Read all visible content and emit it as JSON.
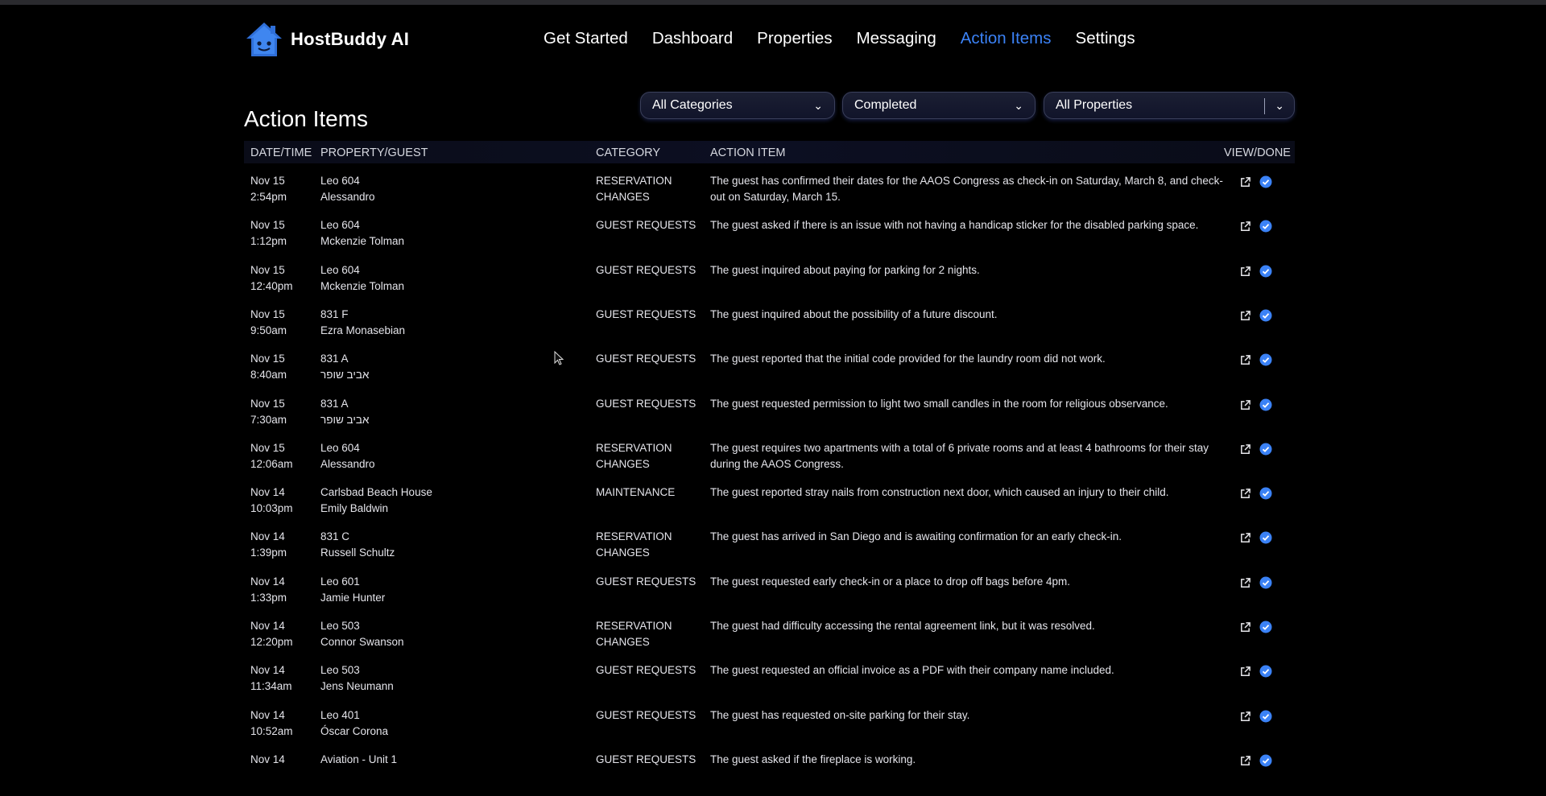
{
  "app": {
    "name": "HostBuddy AI"
  },
  "nav": {
    "items": [
      {
        "label": "Get Started",
        "active": false
      },
      {
        "label": "Dashboard",
        "active": false
      },
      {
        "label": "Properties",
        "active": false
      },
      {
        "label": "Messaging",
        "active": false
      },
      {
        "label": "Action Items",
        "active": true
      },
      {
        "label": "Settings",
        "active": false
      }
    ]
  },
  "page": {
    "title": "Action Items"
  },
  "filters": {
    "category": "All Categories",
    "status": "Completed",
    "properties": "All Properties"
  },
  "table": {
    "headers": {
      "datetime": "DATE/TIME",
      "property": "PROPERTY/GUEST",
      "category": "CATEGORY",
      "action": "ACTION ITEM",
      "view": "VIEW/DONE"
    },
    "rows": [
      {
        "date": "Nov 15",
        "time": "2:54pm",
        "property": "Leo 604",
        "guest": "Alessandro",
        "category": "RESERVATION CHANGES",
        "action": "The guest has confirmed their dates for the AAOS Congress as check-in on Saturday, March 8, and check-out on Saturday, March 15."
      },
      {
        "date": "Nov 15",
        "time": "1:12pm",
        "property": "Leo 604",
        "guest": "Mckenzie Tolman",
        "category": "GUEST REQUESTS",
        "action": "The guest asked if there is an issue with not having a handicap sticker for the disabled parking space."
      },
      {
        "date": "Nov 15",
        "time": "12:40pm",
        "property": "Leo 604",
        "guest": "Mckenzie Tolman",
        "category": "GUEST REQUESTS",
        "action": "The guest inquired about paying for parking for 2 nights."
      },
      {
        "date": "Nov 15",
        "time": "9:50am",
        "property": "831 F",
        "guest": "Ezra Monasebian",
        "category": "GUEST REQUESTS",
        "action": "The guest inquired about the possibility of a future discount."
      },
      {
        "date": "Nov 15",
        "time": "8:40am",
        "property": "831 A",
        "guest": "אביב שופר",
        "category": "GUEST REQUESTS",
        "action": "The guest reported that the initial code provided for the laundry room did not work."
      },
      {
        "date": "Nov 15",
        "time": "7:30am",
        "property": "831 A",
        "guest": "אביב שופר",
        "category": "GUEST REQUESTS",
        "action": "The guest requested permission to light two small candles in the room for religious observance."
      },
      {
        "date": "Nov 15",
        "time": "12:06am",
        "property": "Leo 604",
        "guest": "Alessandro",
        "category": "RESERVATION CHANGES",
        "action": "The guest requires two apartments with a total of 6 private rooms and at least 4 bathrooms for their stay during the AAOS Congress."
      },
      {
        "date": "Nov 14",
        "time": "10:03pm",
        "property": "Carlsbad Beach House",
        "guest": "Emily Baldwin",
        "category": "MAINTENANCE",
        "action": "The guest reported stray nails from construction next door, which caused an injury to their child."
      },
      {
        "date": "Nov 14",
        "time": "1:39pm",
        "property": "831 C",
        "guest": "Russell Schultz",
        "category": "RESERVATION CHANGES",
        "action": "The guest has arrived in San Diego and is awaiting confirmation for an early check-in."
      },
      {
        "date": "Nov 14",
        "time": "1:33pm",
        "property": "Leo 601",
        "guest": "Jamie Hunter",
        "category": "GUEST REQUESTS",
        "action": "The guest requested early check-in or a place to drop off bags before 4pm."
      },
      {
        "date": "Nov 14",
        "time": "12:20pm",
        "property": "Leo 503",
        "guest": "Connor Swanson",
        "category": "RESERVATION CHANGES",
        "action": "The guest had difficulty accessing the rental agreement link, but it was resolved."
      },
      {
        "date": "Nov 14",
        "time": "11:34am",
        "property": "Leo 503",
        "guest": "Jens Neumann",
        "category": "GUEST REQUESTS",
        "action": "The guest requested an official invoice as a PDF with their company name included."
      },
      {
        "date": "Nov 14",
        "time": "10:52am",
        "property": "Leo 401",
        "guest": "Óscar Corona",
        "category": "GUEST REQUESTS",
        "action": "The guest has requested on-site parking for their stay."
      },
      {
        "date": "Nov 14",
        "time": "",
        "property": "Aviation - Unit 1",
        "guest": "",
        "category": "GUEST REQUESTS",
        "action": "The guest asked if the fireplace is working."
      }
    ]
  },
  "colors": {
    "accent": "#3b82f6",
    "background": "#000000",
    "header_row": "#0c0f22"
  }
}
